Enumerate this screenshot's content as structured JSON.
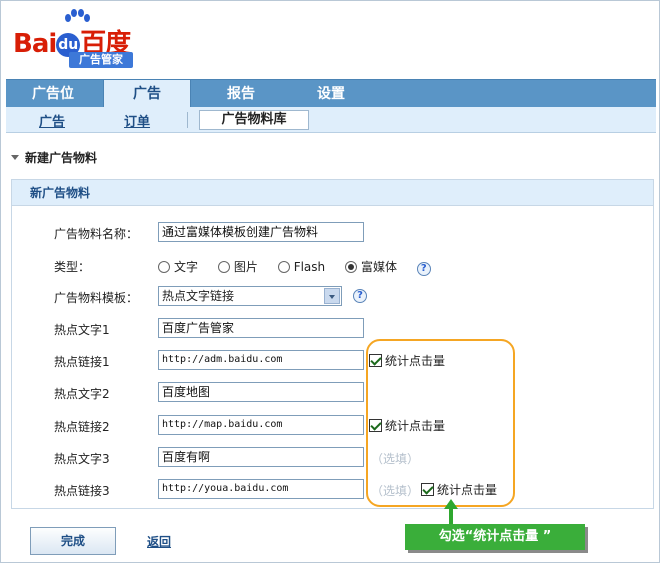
{
  "logo": {
    "text_bai": "Bai",
    "text_du": "du",
    "text_cn": "百度",
    "subtitle": "广告管家"
  },
  "main_nav": [
    "广告位",
    "广告",
    "报告",
    "设置"
  ],
  "sub_nav": {
    "ads": "广告",
    "orders": "订单",
    "library": "广告物料库"
  },
  "section_title": "新建广告物料",
  "panel_title": "新广告物料",
  "form": {
    "name_label": "广告物料名称：",
    "name_value": "通过富媒体模板创建广告物料",
    "type_label": "类型：",
    "type_options": [
      "文字",
      "图片",
      "Flash",
      "富媒体"
    ],
    "type_selected": "富媒体",
    "template_label": "广告物料模板：",
    "template_value": "热点文字链接",
    "help": "?",
    "rows": [
      {
        "label": "热点文字1",
        "value": "百度广告管家"
      },
      {
        "label": "热点链接1",
        "value": "http://adm.baidu.com",
        "check": "统计点击量"
      },
      {
        "label": "热点文字2",
        "value": "百度地图"
      },
      {
        "label": "热点链接2",
        "value": "http://map.baidu.com",
        "check": "统计点击量"
      },
      {
        "label": "热点文字3",
        "value": "百度有啊",
        "optional": "（选填）"
      },
      {
        "label": "热点链接3",
        "value": "http://youa.baidu.com",
        "optional": "（选填）",
        "check": "统计点击量"
      }
    ]
  },
  "callout": "勾选“统计点击量 ”",
  "buttons": {
    "done": "完成",
    "back": "返回"
  },
  "colors": {
    "nav_blue": "#5a95c6",
    "highlight_orange": "#f5a623",
    "callout_green": "#3aae3a"
  }
}
